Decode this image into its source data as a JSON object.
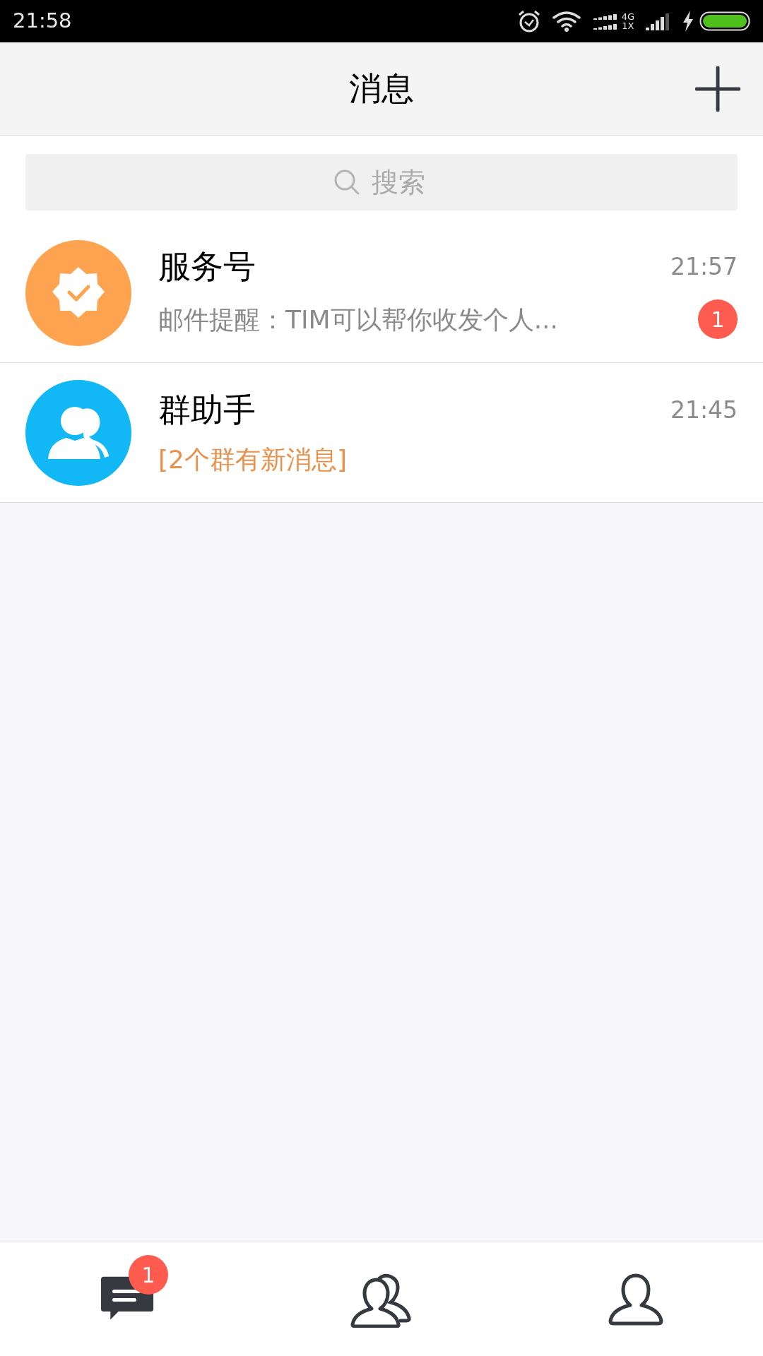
{
  "status_bar": {
    "time": "21:58",
    "network_top": "4G",
    "network_bottom": "1X"
  },
  "header": {
    "title": "消息"
  },
  "search": {
    "placeholder": "搜索"
  },
  "conversations": [
    {
      "kind": "service",
      "name": "服务号",
      "time": "21:57",
      "preview": "邮件提醒：TIM可以帮你收发个人...",
      "preview_highlight": false,
      "badge": "1"
    },
    {
      "kind": "group",
      "name": "群助手",
      "time": "21:45",
      "preview": "[2个群有新消息]",
      "preview_highlight": true
    }
  ],
  "tab_bar": [
    {
      "kind": "messages",
      "selected": true,
      "badge": "1"
    },
    {
      "kind": "contacts",
      "selected": false
    },
    {
      "kind": "me",
      "selected": false
    }
  ]
}
